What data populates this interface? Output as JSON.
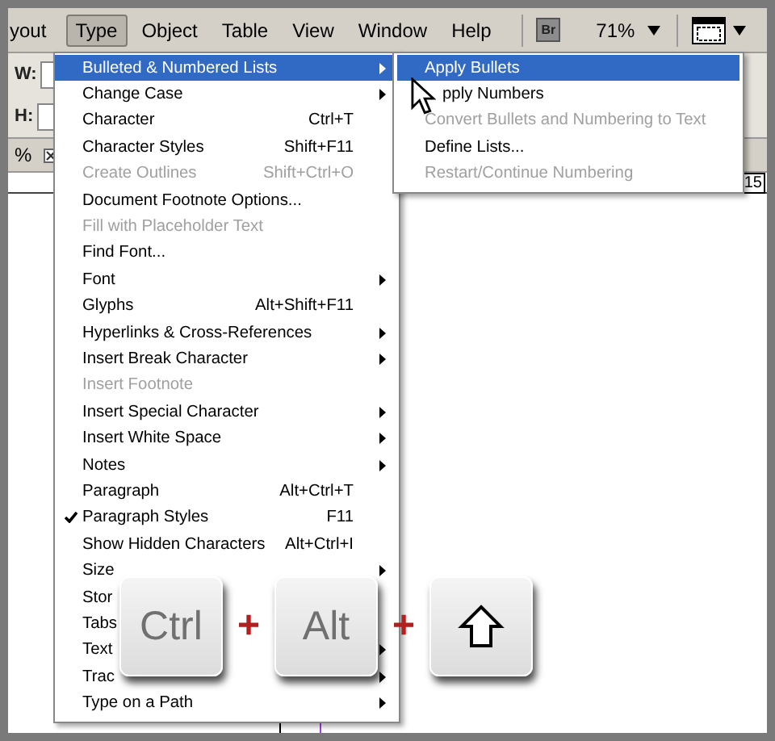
{
  "menubar": [
    {
      "label": "yout",
      "selected": false
    },
    {
      "label": "Type",
      "selected": true
    },
    {
      "label": "Object",
      "selected": false
    },
    {
      "label": "Table",
      "selected": false
    },
    {
      "label": "View",
      "selected": false
    },
    {
      "label": "Window",
      "selected": false
    },
    {
      "label": "Help",
      "selected": false
    }
  ],
  "bridge_button": "Br",
  "zoom": "71%",
  "control_panel": {
    "width_label": "W:",
    "height_label": "H:"
  },
  "doc_tab": {
    "label": "%"
  },
  "ruler_number": "15",
  "type_menu": [
    {
      "label": "Bulleted & Numbered Lists",
      "submenu": true,
      "disabled": false,
      "checked": false,
      "selected": true
    },
    {
      "label": "Change Case",
      "submenu": true,
      "disabled": false,
      "checked": false,
      "selected": false
    },
    {
      "label": "Character",
      "shortcut": "Ctrl+T",
      "submenu": false,
      "disabled": false,
      "checked": false,
      "selected": false
    },
    {
      "label": "Character Styles",
      "shortcut": "Shift+F11",
      "submenu": false,
      "disabled": false,
      "checked": false,
      "selected": false
    },
    {
      "label": "Create Outlines",
      "shortcut": "Shift+Ctrl+O",
      "submenu": false,
      "disabled": true,
      "checked": false,
      "selected": false
    },
    {
      "label": "Document Footnote Options...",
      "submenu": false,
      "disabled": false,
      "checked": false,
      "selected": false
    },
    {
      "label": "Fill with Placeholder Text",
      "submenu": false,
      "disabled": true,
      "checked": false,
      "selected": false
    },
    {
      "label": "Find Font...",
      "submenu": false,
      "disabled": false,
      "checked": false,
      "selected": false
    },
    {
      "label": "Font",
      "submenu": true,
      "disabled": false,
      "checked": false,
      "selected": false
    },
    {
      "label": "Glyphs",
      "shortcut": "Alt+Shift+F11",
      "submenu": false,
      "disabled": false,
      "checked": false,
      "selected": false
    },
    {
      "label": "Hyperlinks & Cross-References",
      "submenu": true,
      "disabled": false,
      "checked": false,
      "selected": false
    },
    {
      "label": "Insert Break Character",
      "submenu": true,
      "disabled": false,
      "checked": false,
      "selected": false
    },
    {
      "label": "Insert Footnote",
      "submenu": false,
      "disabled": true,
      "checked": false,
      "selected": false
    },
    {
      "label": "Insert Special Character",
      "submenu": true,
      "disabled": false,
      "checked": false,
      "selected": false
    },
    {
      "label": "Insert White Space",
      "submenu": true,
      "disabled": false,
      "checked": false,
      "selected": false
    },
    {
      "label": "Notes",
      "submenu": true,
      "disabled": false,
      "checked": false,
      "selected": false
    },
    {
      "label": "Paragraph",
      "shortcut": "Alt+Ctrl+T",
      "submenu": false,
      "disabled": false,
      "checked": false,
      "selected": false
    },
    {
      "label": "Paragraph Styles",
      "shortcut": "F11",
      "submenu": false,
      "disabled": false,
      "checked": true,
      "selected": false
    },
    {
      "label": "Show Hidden Characters",
      "shortcut": "Alt+Ctrl+I",
      "submenu": false,
      "disabled": false,
      "checked": false,
      "selected": false
    },
    {
      "label": "Size",
      "submenu": true,
      "disabled": false,
      "checked": false,
      "selected": false
    },
    {
      "label": "Stor",
      "submenu": false,
      "disabled": false,
      "checked": false,
      "selected": false
    },
    {
      "label": "Tabs",
      "submenu": false,
      "disabled": false,
      "checked": false,
      "selected": false
    },
    {
      "label": "Text",
      "submenu": true,
      "disabled": false,
      "checked": false,
      "selected": false
    },
    {
      "label": "Trac",
      "submenu": true,
      "disabled": false,
      "checked": false,
      "selected": false
    },
    {
      "label": "Type on a Path",
      "submenu": true,
      "disabled": false,
      "checked": false,
      "selected": false
    }
  ],
  "lists_submenu": [
    {
      "label": "Apply Bullets",
      "disabled": false,
      "selected": true
    },
    {
      "label": "pply Numbers",
      "disabled": false,
      "selected": false
    },
    {
      "label": "Convert Bullets and Numbering to Text",
      "disabled": true,
      "selected": false
    },
    {
      "label": "Define Lists...",
      "disabled": false,
      "selected": false
    },
    {
      "label": "Restart/Continue Numbering",
      "disabled": true,
      "selected": false
    }
  ],
  "keys": [
    {
      "kind": "text",
      "label": "Ctrl"
    },
    {
      "kind": "plus",
      "label": "+"
    },
    {
      "kind": "text",
      "label": "Alt"
    },
    {
      "kind": "plus",
      "label": "+"
    },
    {
      "kind": "shift"
    }
  ]
}
